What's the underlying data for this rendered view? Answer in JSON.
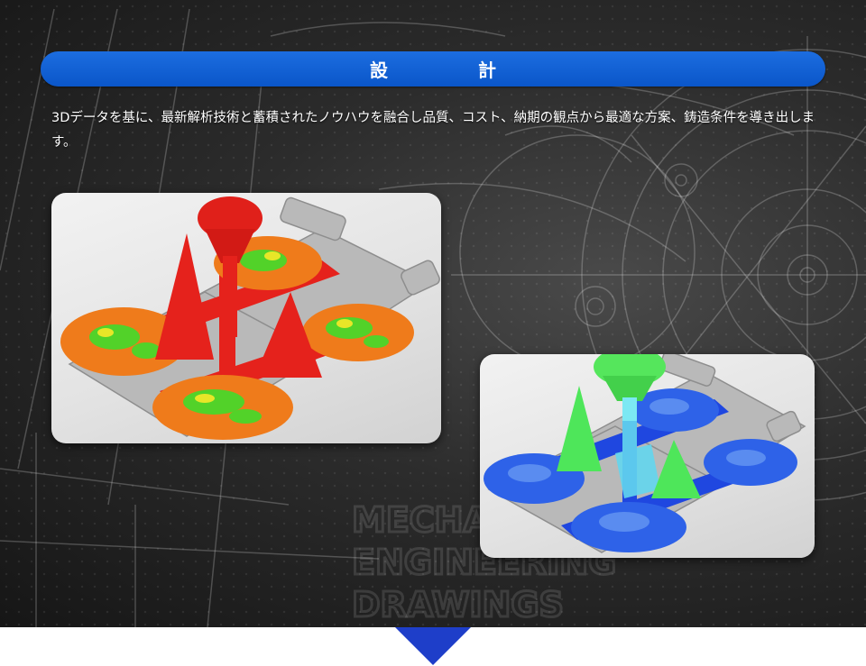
{
  "section": {
    "title": "設　計",
    "description": "3Dデータを基に、最新解析技術と蓄積されたノウハウを融合し品質、コスト、納期の観点から最適な方案、鋳造条件を導き出します。"
  },
  "background": {
    "watermark_lines": [
      "MECHANICAL",
      "ENGINEERING",
      "DRAWINGS"
    ]
  },
  "images": [
    {
      "icon": "casting-simulation-thermal-image"
    },
    {
      "icon": "casting-simulation-flow-image"
    }
  ],
  "colors": {
    "title_bar": "#0a56c9",
    "arrow": "#1e3ec9",
    "background": "#2c2c2c"
  }
}
